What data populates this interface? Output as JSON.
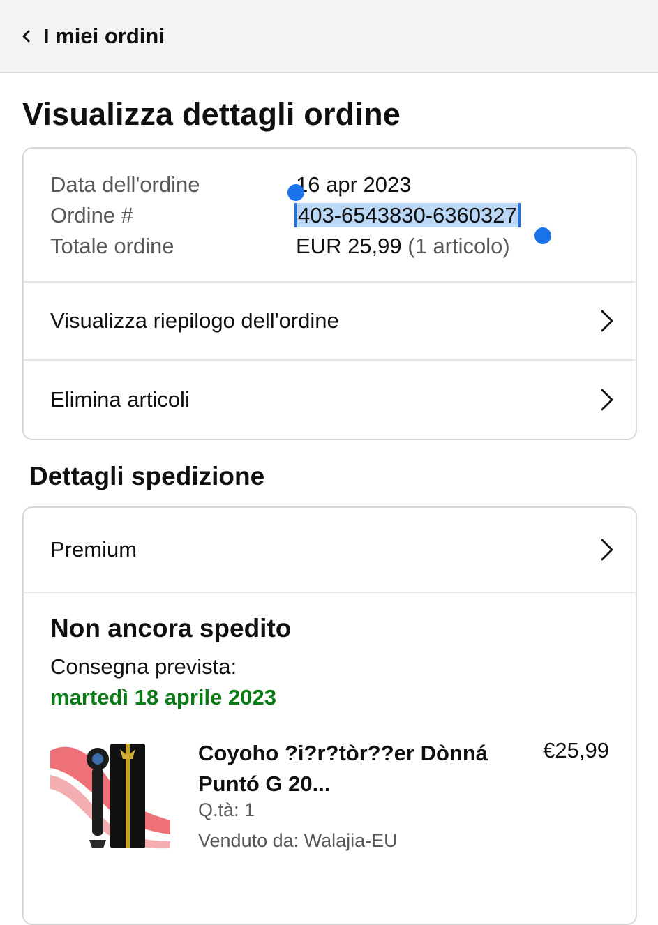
{
  "header": {
    "back_label": "I miei ordini"
  },
  "page_title": "Visualizza dettagli ordine",
  "order_info": {
    "date_label": "Data dell'ordine",
    "date_value": "16 apr 2023",
    "number_label": "Ordine #",
    "number_value": "403-6543830-6360327",
    "total_label": "Totale ordine",
    "total_value": "EUR 25,99",
    "total_items": "(1 articolo)"
  },
  "order_actions": {
    "summary_label": "Visualizza riepilogo dell'ordine",
    "delete_label": "Elimina articoli"
  },
  "shipping": {
    "section_title": "Dettagli spedizione",
    "method_label": "Premium",
    "status": "Non ancora spedito",
    "delivery_label": "Consegna prevista:",
    "delivery_date": "martedì 18 aprile 2023"
  },
  "product": {
    "title": "Coyoho ?i?r?tòr??er Dònná Puntó G 20...",
    "price": "€25,99",
    "quantity": "Q.tà: 1",
    "seller": "Venduto da: Walajia-EU"
  },
  "colors": {
    "delivery_green": "#0a7b14",
    "selection_blue": "#1a73e8",
    "selection_fill": "#bcd8f7"
  }
}
